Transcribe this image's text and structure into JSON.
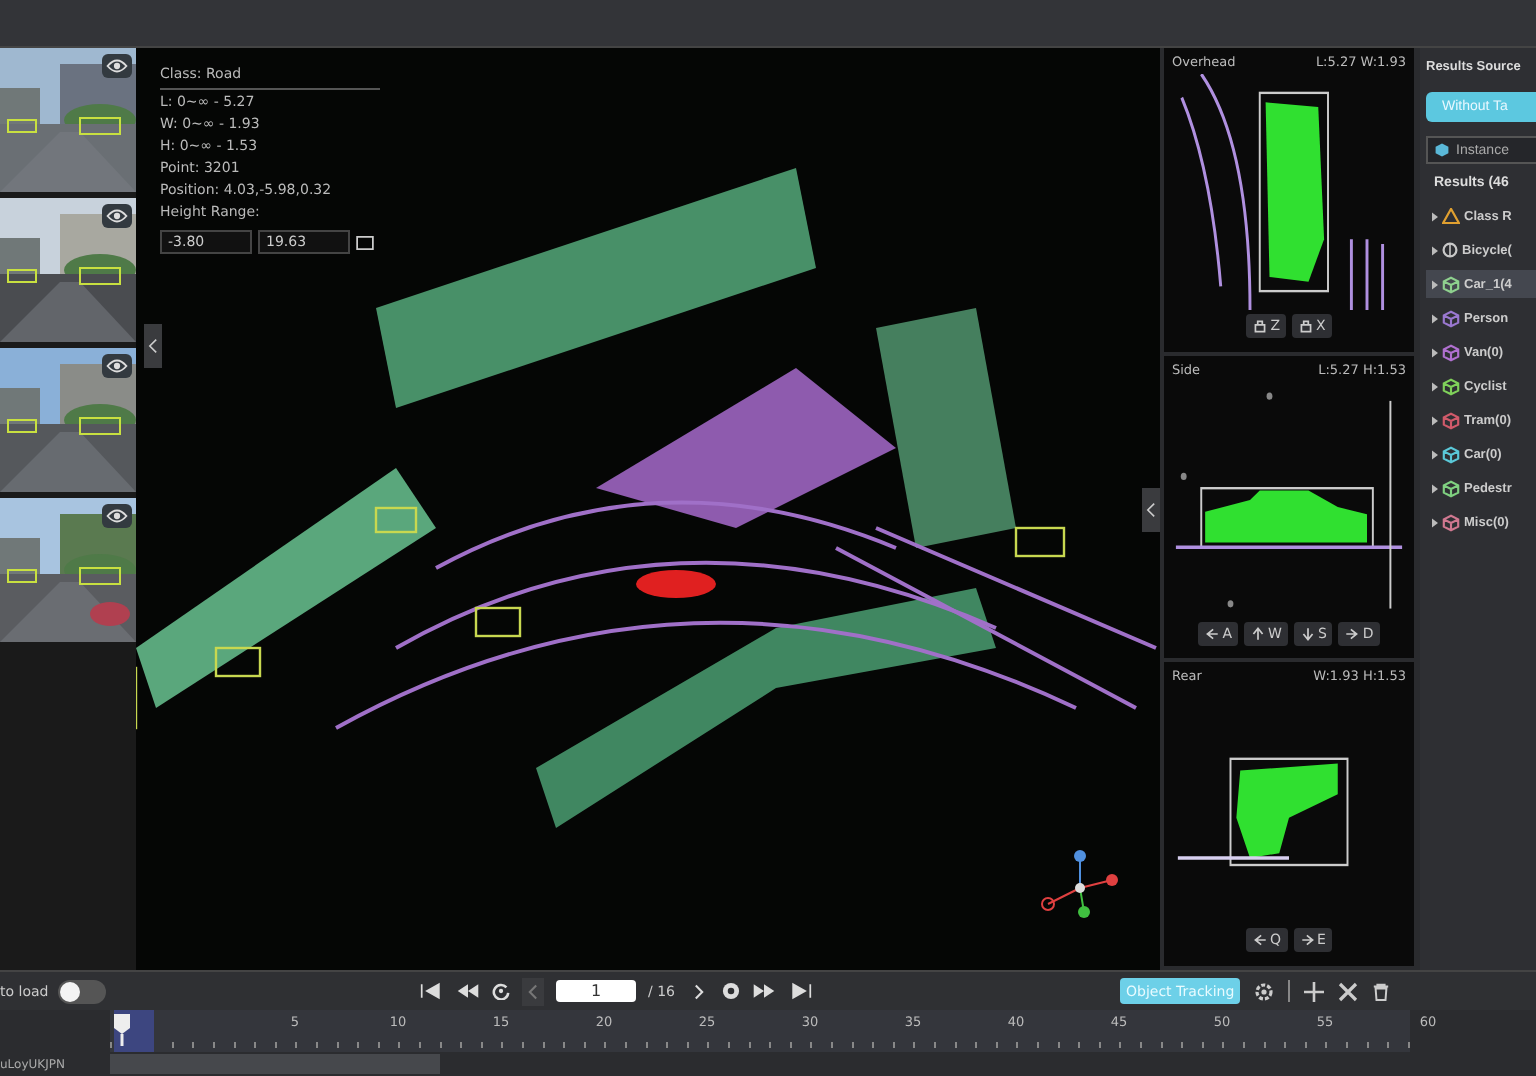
{
  "info": {
    "lines": [
      "Class: Road",
      "L: 0~∞ - 5.27",
      "W: 0~∞ - 1.93",
      "H: 0~∞ - 1.53",
      "Point: 3201",
      "Position: 4.03,-5.98,0.32",
      "Height Range:"
    ],
    "height_min": "-3.80",
    "height_max": "19.63"
  },
  "views": [
    {
      "title": "Overhead",
      "dims": "L:5.27 W:1.93",
      "keys": [
        {
          "label": "Z"
        },
        {
          "label": "X"
        }
      ]
    },
    {
      "title": "Side",
      "dims": "L:5.27 H:1.53",
      "keys": [
        {
          "label": "A"
        },
        {
          "label": "W"
        },
        {
          "label": "S"
        },
        {
          "label": "D"
        }
      ]
    },
    {
      "title": "Rear",
      "dims": "W:1.93 H:1.53",
      "keys": [
        {
          "label": "Q"
        },
        {
          "label": "E"
        }
      ]
    }
  ],
  "results": {
    "title": "Results Source",
    "source_button": "Without Ta",
    "mode": "Instance",
    "header": "Results (46",
    "items": [
      {
        "kind": "warning",
        "label": "Class R",
        "color": "#e0a030",
        "selected": false
      },
      {
        "kind": "wheel",
        "label": "Bicycle(",
        "color": "#c8c8c8",
        "selected": false
      },
      {
        "kind": "cube",
        "label": "Car_1(4",
        "color": "#8ed08e",
        "selected": true
      },
      {
        "kind": "cube",
        "label": "Person",
        "color": "#9a78d0",
        "selected": false
      },
      {
        "kind": "cube",
        "label": "Van(0)",
        "color": "#b070d0",
        "selected": false
      },
      {
        "kind": "cube",
        "label": "Cyclist",
        "color": "#7fd05a",
        "selected": false
      },
      {
        "kind": "cube",
        "label": "Tram(0)",
        "color": "#d05a6a",
        "selected": false
      },
      {
        "kind": "cube",
        "label": "Car(0)",
        "color": "#5ac8d8",
        "selected": false
      },
      {
        "kind": "cube",
        "label": "Pedestr",
        "color": "#7fd080",
        "selected": false
      },
      {
        "kind": "cube",
        "label": "Misc(0)",
        "color": "#d07890",
        "selected": false
      }
    ]
  },
  "toolbar": {
    "autoload_label": "to load",
    "autoload_on": false,
    "page": "1",
    "page_total": "/ 16",
    "tracking_button": "Object Tracking"
  },
  "timeline": {
    "ticks": [
      "5",
      "10",
      "15",
      "20",
      "25",
      "30",
      "35",
      "40",
      "45",
      "50",
      "55",
      "60"
    ],
    "track_label": "uLoyUKJPN"
  }
}
